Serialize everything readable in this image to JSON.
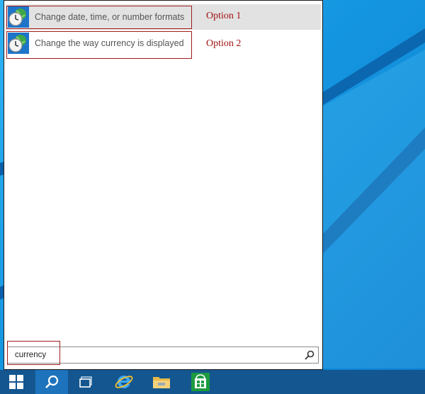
{
  "search_results": [
    {
      "label": "Change date, time, or number formats",
      "icon": "clock-globe-icon",
      "selected": true
    },
    {
      "label": "Change the way currency is displayed",
      "icon": "clock-globe-icon",
      "selected": false
    }
  ],
  "annotations": {
    "option1": "Option 1",
    "option2": "Option 2"
  },
  "search": {
    "query": "currency",
    "go_icon": "search-icon"
  },
  "taskbar": {
    "items": [
      "windows-start-icon",
      "search-icon",
      "task-view-icon",
      "internet-explorer-icon",
      "file-explorer-icon",
      "store-icon"
    ]
  },
  "colors": {
    "annotation": "#a01212",
    "taskbar": "#14568f",
    "selected_row": "#e2e2e2",
    "desktop": "#1596e0"
  }
}
